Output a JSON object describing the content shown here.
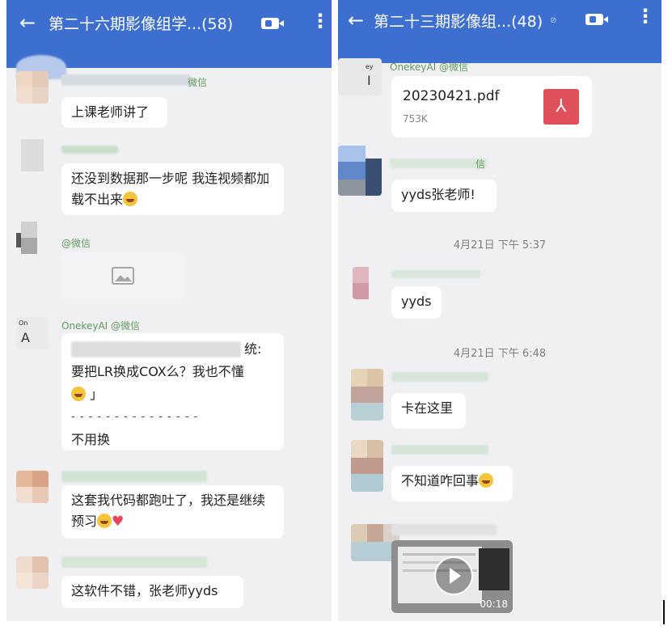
{
  "left": {
    "title": "第二十六期影像组学...(58)",
    "icons": {
      "back": "back-arrow-icon",
      "video": "video-call-icon",
      "more": "more-vertical-icon"
    },
    "messages": [
      {
        "sender": "微信",
        "text": "上课老师讲了"
      },
      {
        "text": "还没到数据那一步呢 我连视频都加载不出来"
      },
      {
        "sender": "@微信",
        "image": "image-placeholder-icon"
      },
      {
        "sender": "OnekeyAI @微信",
        "quote_tail": "统:",
        "quote_line2": "要把LR换成COX么？我也不懂",
        "quote_close": "」",
        "separator": "- - - - - - - - - - - - - - -",
        "reply": "不用换"
      },
      {
        "text": "这套我代码都跑吐了，我还是继续预习"
      },
      {
        "text": "这软件不错，张老师yyds"
      }
    ]
  },
  "right": {
    "title": "第二十三期影像组...(48)",
    "messages": [
      {
        "sender": "OnekeyAI @微信",
        "file_name": "20230421.pdf",
        "file_size": "753K"
      },
      {
        "sender": "信",
        "text": "yyds张老师!"
      },
      {
        "time": "4月21日  下午 5:37"
      },
      {
        "text": "yyds"
      },
      {
        "time": "4月21日  下午 6:48"
      },
      {
        "text": "卡在这里"
      },
      {
        "text": "不知道咋回事"
      },
      {
        "video_duration": "00:18"
      }
    ]
  }
}
